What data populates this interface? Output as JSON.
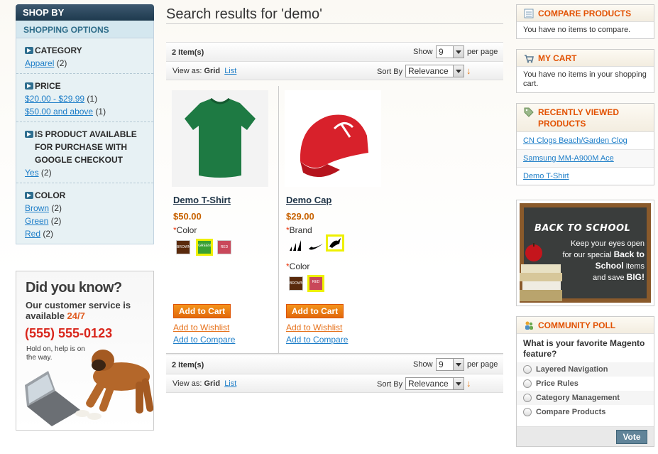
{
  "sidebar": {
    "shop_by": "SHOP BY",
    "shopping_options": "SHOPPING OPTIONS",
    "filters": [
      {
        "title": "CATEGORY",
        "items": [
          {
            "label": "Apparel",
            "count": "(2)"
          }
        ]
      },
      {
        "title": "PRICE",
        "items": [
          {
            "label": "$20.00 - $29.99",
            "count": "(1)"
          },
          {
            "label": "$50.00 and above",
            "count": "(1)"
          }
        ]
      },
      {
        "title": "IS PRODUCT AVAILABLE FOR PURCHASE WITH GOOGLE CHECKOUT",
        "items": [
          {
            "label": "Yes",
            "count": "(2)"
          }
        ]
      },
      {
        "title": "COLOR",
        "items": [
          {
            "label": "Brown",
            "count": "(2)"
          },
          {
            "label": "Green",
            "count": "(2)"
          },
          {
            "label": "Red",
            "count": "(2)"
          }
        ]
      }
    ],
    "banner": {
      "title": "Did you know?",
      "line1": "Our customer service is",
      "line2": "available ",
      "hours": "24/7",
      "phone": "(555) 555-0123",
      "hold": "Hold on, help is on the way."
    }
  },
  "main": {
    "title": "Search results for 'demo'",
    "toolbar": {
      "items": "2 Item(s)",
      "show": "Show",
      "show_value": "9",
      "per_page": "per page",
      "view_as": "View as:",
      "grid": "Grid",
      "list": "List",
      "sort_by": "Sort By",
      "sort_value": "Relevance",
      "sort_arrow": "↓"
    },
    "products": [
      {
        "name": "Demo T-Shirt",
        "price": "$50.00",
        "attr1_label": "Color",
        "swatches1": [
          "BROWN",
          "GREEN",
          "RED"
        ],
        "add_to_cart": "Add to Cart",
        "wishlist": "Add to Wishlist",
        "compare": "Add to Compare"
      },
      {
        "name": "Demo Cap",
        "price": "$29.00",
        "attr1_label": "Brand",
        "attr2_label": "Color",
        "swatches2": [
          "BROWN",
          "RED"
        ],
        "add_to_cart": "Add to Cart",
        "wishlist": "Add to Wishlist",
        "compare": "Add to Compare"
      }
    ]
  },
  "right": {
    "compare": {
      "title": "COMPARE PRODUCTS",
      "body": "You have no items to compare."
    },
    "cart": {
      "title": "MY CART",
      "body": "You have no items in your shopping cart."
    },
    "recent": {
      "title": "RECENTLY VIEWED PRODUCTS",
      "items": [
        "CN Clogs Beach/Garden Clog",
        "Samsung MM-A900M Ace",
        "Demo T-Shirt"
      ]
    },
    "promo": {
      "title": "BACK TO SCHOOL",
      "line1": "Keep your eyes open",
      "line2": "for our special ",
      "bold1": "Back to School",
      "line3": " items",
      "line4": "and save ",
      "bold2": "BIG!"
    },
    "poll": {
      "title": "COMMUNITY POLL",
      "question": "What is your favorite Magento feature?",
      "options": [
        "Layered Navigation",
        "Price Rules",
        "Category Management",
        "Compare Products"
      ],
      "vote": "Vote"
    }
  },
  "colors": {
    "accent_orange": "#e25203",
    "link_blue": "#1e7ec8",
    "swatch_brown": "#5a2a0c",
    "swatch_green": "#3aa032",
    "swatch_red": "#c9485a"
  }
}
